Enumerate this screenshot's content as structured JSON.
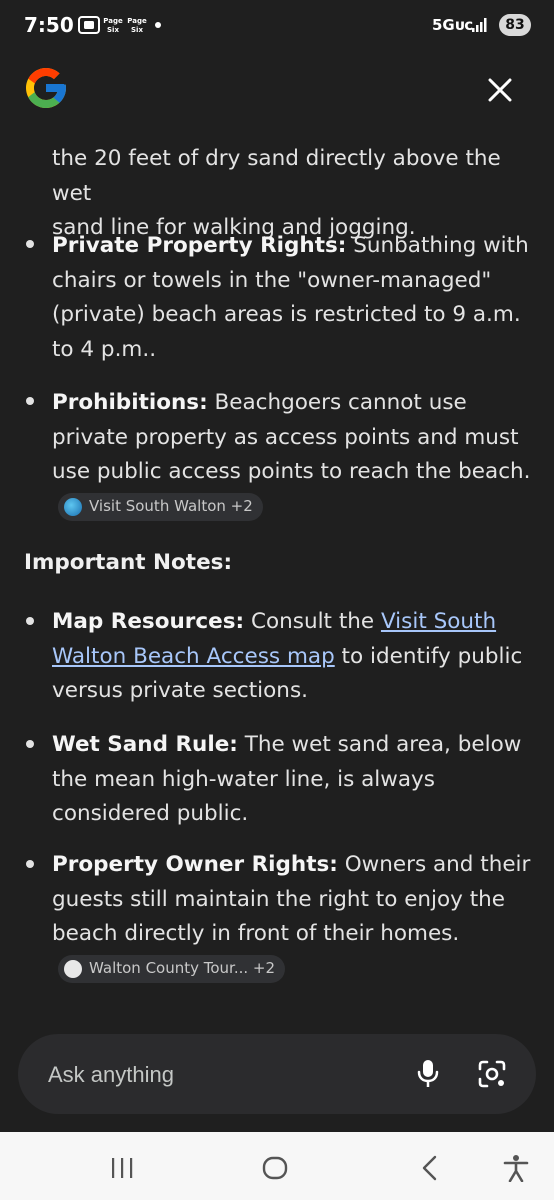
{
  "status_bar": {
    "time": "7:50",
    "network": "5Gᴜᴄ",
    "battery": "83",
    "icons": [
      "screenshot-icon",
      "page-six-icon",
      "page-six-icon",
      "notification-dot-icon",
      "signal-icon",
      "battery-icon"
    ]
  },
  "header": {
    "logo": "google-g-logo",
    "close_icon": "close-icon"
  },
  "content": {
    "partial_line_1": "the 20 feet of dry sand directly above the wet",
    "partial_line_2": "sand line for walking and jogging.",
    "bullets_1": [
      {
        "title": "Private Property Rights:",
        "text": " Sunbathing with chairs or towels in the \"owner-managed\" (private) beach areas is restricted to 9 a.m. to 4 p.m.."
      },
      {
        "title": "Prohibitions:",
        "text": " Beachgoers cannot use private property as access points and must use public access points to reach the beach.",
        "chip": "Visit South Walton +2"
      }
    ],
    "heading": "Important Notes:",
    "bullets_2": [
      {
        "title": "Map Resources:",
        "text_before": " Consult the ",
        "link": "Visit South Walton Beach Access map",
        "text_after": " to identify public versus private sections."
      },
      {
        "title": "Wet Sand Rule:",
        "text": " The wet sand area, below the mean high-water line, is always considered public."
      },
      {
        "title": "Property Owner Rights:",
        "text": " Owners and their guests still maintain the right to enjoy the beach directly in front of their homes.",
        "chip": "Walton County Tour... +2"
      }
    ]
  },
  "ask_bar": {
    "placeholder": "Ask anything",
    "mic_icon": "microphone-icon",
    "lens_icon": "camera-search-icon"
  },
  "nav_bar": {
    "icons": [
      "recent-apps-icon",
      "home-icon",
      "back-icon",
      "accessibility-icon"
    ]
  },
  "colors": {
    "background": "#1f1f1f",
    "text": "#e3e3e3",
    "link": "#a8c7fa",
    "chip_bg": "#303134",
    "nav_bg": "#f7f7f7"
  }
}
